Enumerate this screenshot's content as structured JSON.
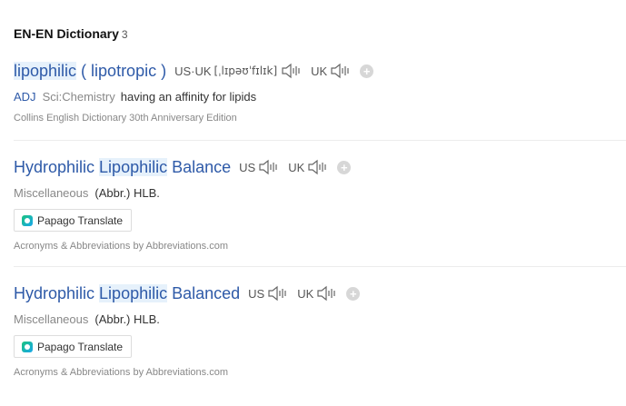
{
  "section": {
    "title": "EN-EN Dictionary",
    "count": "3"
  },
  "entries": [
    {
      "word_plain": "",
      "word_hl": "lipophilic",
      "word_rest": " ( lipotropic )",
      "us_label": "US·UK",
      "ipa": "[ˌlɪpəʊˈfɪlɪk]",
      "uk_label": "UK",
      "pos": "ADJ",
      "field": "Sci:Chemistry",
      "definition": "having an affinity for lipids",
      "source": "Collins English Dictionary 30th Anniversary Edition"
    },
    {
      "word_pre": "Hydrophilic ",
      "word_hl": "Lipophilic",
      "word_post": " Balance",
      "us_label": "US",
      "uk_label": "UK",
      "category": "Miscellaneous",
      "abbr": "(Abbr.)",
      "abbr_value": "HLB.",
      "translate_label": "Papago Translate",
      "source": "Acronyms & Abbreviations by Abbreviations.com"
    },
    {
      "word_pre": "Hydrophilic ",
      "word_hl": "Lipophilic",
      "word_post": " Balanced",
      "us_label": "US",
      "uk_label": "UK",
      "category": "Miscellaneous",
      "abbr": "(Abbr.)",
      "abbr_value": "HLB.",
      "translate_label": "Papago Translate",
      "source": "Acronyms & Abbreviations by Abbreviations.com"
    }
  ],
  "icons": {
    "speaker": "speaker-icon",
    "add": "add-icon",
    "papago": "papago-logo-icon"
  },
  "colors": {
    "link": "#2e5aa8",
    "highlight": "#e6f1fb",
    "muted": "#888888"
  },
  "glyphs": {
    "plus": "+"
  }
}
